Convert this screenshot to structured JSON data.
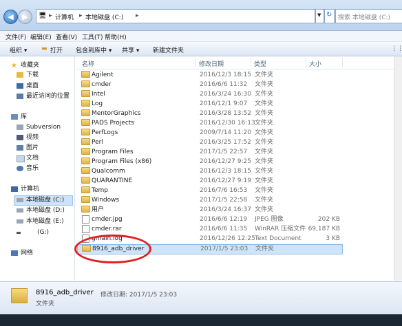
{
  "address": {
    "crumbs": [
      "计算机",
      "本地磁盘 (C:)"
    ],
    "search_placeholder": "搜索 本地磁盘 (C:)"
  },
  "menu": [
    "文件(F)",
    "编辑(E)",
    "查看(V)",
    "工具(T)",
    "帮助(H)"
  ],
  "toolbar": [
    "组织 ▾",
    "打开",
    "包含到库中 ▾",
    "共享 ▾",
    "新建文件夹"
  ],
  "nav": {
    "favorites": "收藏夹",
    "fav_items": [
      "下载",
      "桌面",
      "最近访问的位置"
    ],
    "library": "库",
    "lib_items": [
      "Subversion",
      "视频",
      "图片",
      "文档",
      "音乐"
    ],
    "computer": "计算机",
    "drives": [
      "本地磁盘 (C:)",
      "本地磁盘 (D:)",
      "本地磁盘 (E:)",
      "(G:)"
    ],
    "network": "网络"
  },
  "columns": [
    "名称",
    "修改日期",
    "类型",
    "大小"
  ],
  "rows": [
    {
      "name": "Agilent",
      "date": "2016/12/3 18:15",
      "type": "文件夹",
      "size": ""
    },
    {
      "name": "cmder",
      "date": "2016/6/6 11:32",
      "type": "文件夹",
      "size": ""
    },
    {
      "name": "Intel",
      "date": "2016/3/24 16:30",
      "type": "文件夹",
      "size": ""
    },
    {
      "name": "Log",
      "date": "2016/12/1 9:07",
      "type": "文件夹",
      "size": ""
    },
    {
      "name": "MentorGraphics",
      "date": "2016/3/28 13:52",
      "type": "文件夹",
      "size": ""
    },
    {
      "name": "PADS Projects",
      "date": "2016/12/30 16:13",
      "type": "文件夹",
      "size": ""
    },
    {
      "name": "PerfLogs",
      "date": "2009/7/14 11:20",
      "type": "文件夹",
      "size": ""
    },
    {
      "name": "Perl",
      "date": "2016/3/25 17:52",
      "type": "文件夹",
      "size": ""
    },
    {
      "name": "Program Files",
      "date": "2017/1/5 22:57",
      "type": "文件夹",
      "size": ""
    },
    {
      "name": "Program Files (x86)",
      "date": "2016/12/27 9:25",
      "type": "文件夹",
      "size": ""
    },
    {
      "name": "Qualcomm",
      "date": "2016/12/3 18:15",
      "type": "文件夹",
      "size": ""
    },
    {
      "name": "QUARANTINE",
      "date": "2016/12/27 9:19",
      "type": "文件夹",
      "size": ""
    },
    {
      "name": "Temp",
      "date": "2016/7/6 16:53",
      "type": "文件夹",
      "size": ""
    },
    {
      "name": "Windows",
      "date": "2017/1/5 22:58",
      "type": "文件夹",
      "size": ""
    },
    {
      "name": "用户",
      "date": "2016/3/24 16:37",
      "type": "文件夹",
      "size": ""
    },
    {
      "name": "cmder.jpg",
      "date": "2016/6/6 12:19",
      "type": "JPEG 图像",
      "size": "202 KB"
    },
    {
      "name": "cmder.rar",
      "date": "2016/6/6 11:35",
      "type": "WinRAR 压缩文件",
      "size": "69,187 KB"
    },
    {
      "name": "gmain.log",
      "date": "2016/12/26 12:25",
      "type": "Text Document",
      "size": "3 KB"
    },
    {
      "name": "8916_adb_driver",
      "date": "2017/1/5 23:03",
      "type": "文件夹",
      "size": ""
    }
  ],
  "details": {
    "name": "8916_adb_driver",
    "meta": "修改日期: 2017/1/5 23:03",
    "kind": "文件夹"
  }
}
